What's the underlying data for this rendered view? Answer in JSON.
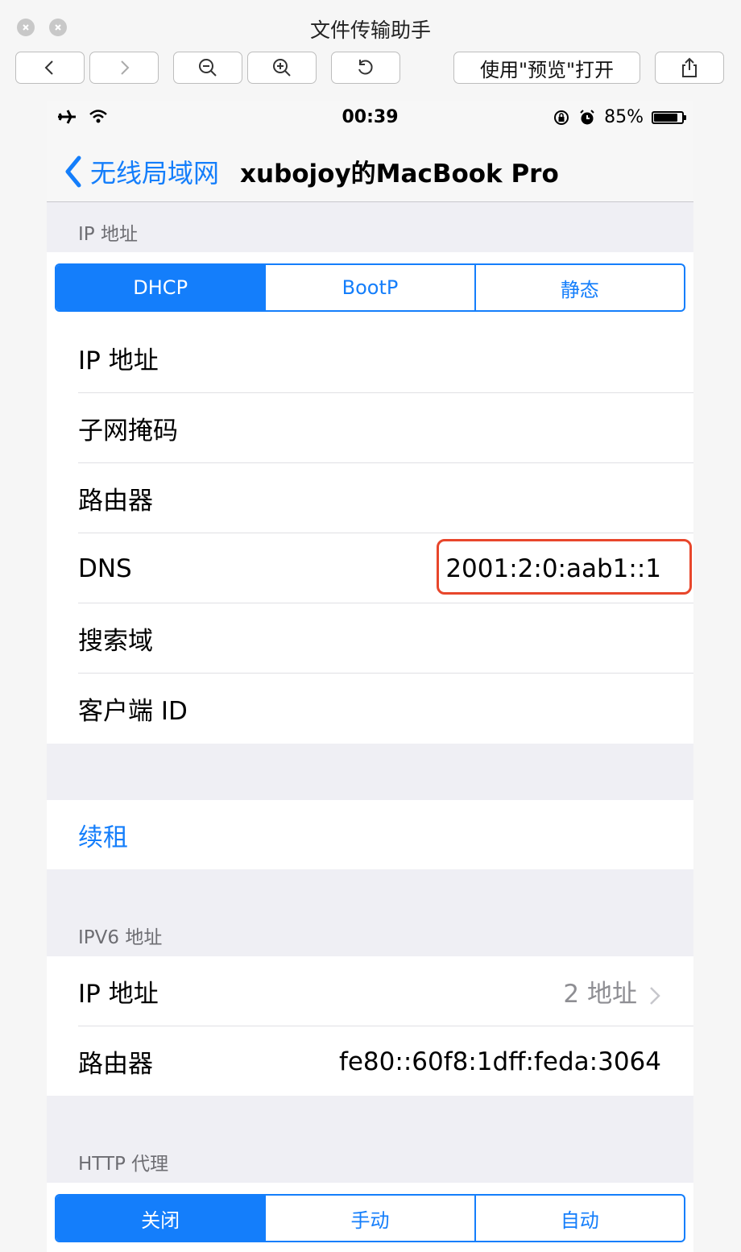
{
  "window": {
    "title": "文件传输助手",
    "open_with_preview_label": "使用\"预览\"打开"
  },
  "statusbar": {
    "time": "00:39",
    "battery_text": "85%",
    "battery_level": 0.85
  },
  "navbar": {
    "back_label": "无线局域网",
    "title": "xubojoy的MacBook Pro"
  },
  "ipv4": {
    "section_title": "IP 地址",
    "modes": [
      "DHCP",
      "BootP",
      "静态"
    ],
    "selected_mode": "DHCP",
    "rows": [
      {
        "label": "IP 地址",
        "value": ""
      },
      {
        "label": "子网掩码",
        "value": ""
      },
      {
        "label": "路由器",
        "value": ""
      },
      {
        "label": "DNS",
        "value": "2001:2:0:aab1::1"
      },
      {
        "label": "搜索域",
        "value": ""
      },
      {
        "label": "客户端 ID",
        "value": ""
      }
    ]
  },
  "renew": {
    "label": "续租"
  },
  "ipv6": {
    "section_title": "IPV6 地址",
    "rows": [
      {
        "label": "IP 地址",
        "value": "2 地址"
      },
      {
        "label": "路由器",
        "value": "fe80::60f8:1dff:feda:3064"
      }
    ]
  },
  "http_proxy": {
    "section_title": "HTTP 代理",
    "modes": [
      "关闭",
      "手动",
      "自动"
    ],
    "selected_mode": "关闭"
  },
  "colors": {
    "accent": "#147efb",
    "highlight": "#e8462b",
    "group_background": "#efeff4"
  }
}
